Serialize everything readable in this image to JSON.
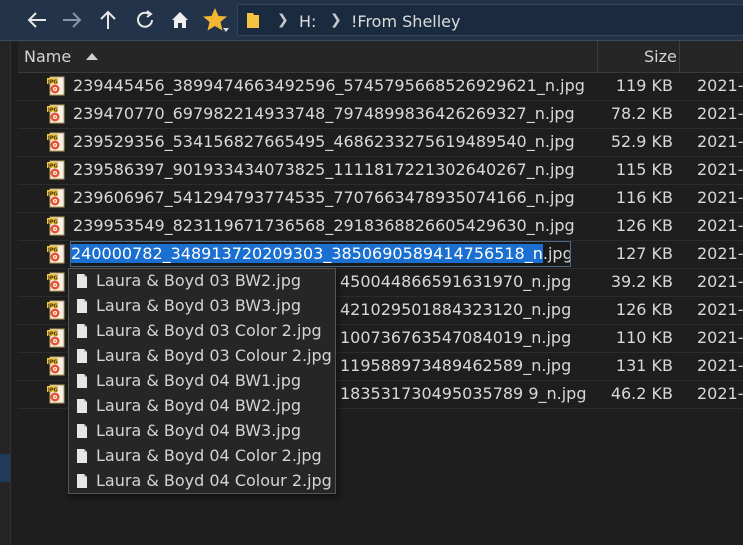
{
  "toolbar": {
    "back_icon": "back-arrow-icon",
    "forward_icon": "forward-arrow-icon",
    "up_icon": "up-arrow-icon",
    "refresh_icon": "refresh-icon",
    "home_icon": "home-icon",
    "favorites_icon": "star-icon"
  },
  "address": {
    "crumbs": [
      "H:",
      "!From Shelley"
    ]
  },
  "header": {
    "name_label": "Name",
    "size_label": "Size"
  },
  "files": [
    {
      "name": "239445456_3899474663492596_5745795668526929621_n.jpg",
      "size": "119 KB",
      "date": "2021-"
    },
    {
      "name": "239470770_697982214933748_7974899836426269327_n.jpg",
      "size": "78.2 KB",
      "date": "2021-"
    },
    {
      "name": "239529356_534156827665495_4686233275619489540_n.jpg",
      "size": "52.9 KB",
      "date": "2021-"
    },
    {
      "name": "239586397_901933434073825_1111817221302640267_n.jpg",
      "size": "115 KB",
      "date": "2021-"
    },
    {
      "name": "239606967_541294793774535_7707663478935074166_n.jpg",
      "size": "116 KB",
      "date": "2021-"
    },
    {
      "name": "239953549_823119671736568_2918368826605429630_n.jpg",
      "size": "126 KB",
      "date": "2021-"
    },
    {
      "name": "",
      "size": "127 KB",
      "date": "2021-"
    },
    {
      "name": "450044866591631970_n.jpg",
      "size": "39.2 KB",
      "date": "2021-"
    },
    {
      "name": "421029501884323120_n.jpg",
      "size": "126 KB",
      "date": "2021-"
    },
    {
      "name": "100736763547084019_n.jpg",
      "size": "110 KB",
      "date": "2021-"
    },
    {
      "name": "119588973489462589_n.jpg",
      "size": "131 KB",
      "date": "2021-"
    },
    {
      "name": "183531730495035789 9_n.jpg",
      "size": "46.2 KB",
      "date": "2021-"
    }
  ],
  "rename": {
    "selected_text": "240000782_348913720209303_3850690589414756518_n",
    "rest_text": ".jpg"
  },
  "autocomplete": [
    "Laura & Boyd 03 BW2.jpg",
    "Laura & Boyd 03 BW3.jpg",
    "Laura & Boyd 03 Color 2.jpg",
    "Laura & Boyd 03 Colour 2.jpg",
    "Laura & Boyd 04 BW1.jpg",
    "Laura & Boyd 04 BW2.jpg",
    "Laura & Boyd 04 BW3.jpg",
    "Laura & Boyd 04 Color 2.jpg",
    "Laura & Boyd 04 Colour 2.jpg"
  ],
  "colors": {
    "toolbar_bg": "#23344a",
    "selection": "#1a6fd0",
    "star": "#f2b632",
    "folder": "#f5c242"
  }
}
